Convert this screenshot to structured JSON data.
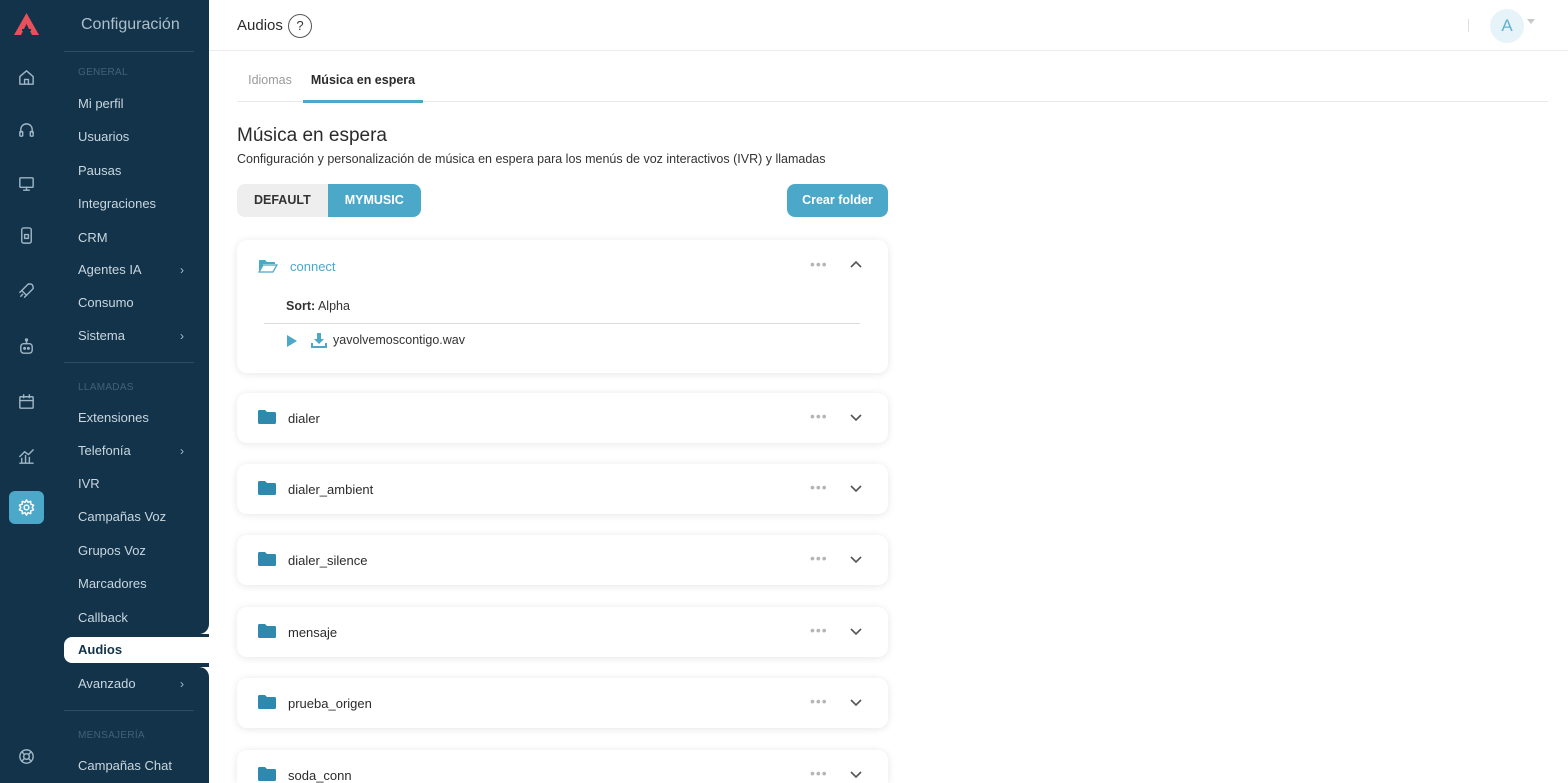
{
  "menu": {
    "title": "Configuración",
    "sections": {
      "general": "GENERAL",
      "llamadas": "LLAMADAS",
      "mensajeria": "MENSAJERÍA"
    },
    "general_items": [
      "Mi perfil",
      "Usuarios",
      "Pausas",
      "Integraciones",
      "CRM",
      "Agentes IA",
      "Consumo",
      "Sistema"
    ],
    "llamadas_items": [
      "Extensiones",
      "Telefonía",
      "IVR",
      "Campañas Voz",
      "Grupos Voz",
      "Marcadores",
      "Callback",
      "Audios",
      "Avanzado"
    ],
    "mensajeria_items": [
      "Campañas Chat"
    ],
    "active_item": "Audios",
    "chevron": "›"
  },
  "header": {
    "title": "Audios",
    "help": "?",
    "avatar_initial": "A"
  },
  "tabs": [
    "Idiomas",
    "Música en espera"
  ],
  "active_tab": "Música en espera",
  "content": {
    "heading": "Música en espera",
    "description": "Configuración y personalización de música en espera para los menús de voz interactivos (IVR) y llamadas",
    "segment": [
      "DEFAULT",
      "MYMUSIC"
    ],
    "selected_segment": "MYMUSIC",
    "create_button": "Crear folder"
  },
  "folders": [
    {
      "name": "connect",
      "expanded": true,
      "sort_label": "Sort:",
      "sort_value": "Alpha",
      "files": [
        "yavolvemoscontigo.wav"
      ]
    },
    {
      "name": "dialer",
      "expanded": false
    },
    {
      "name": "dialer_ambient",
      "expanded": false
    },
    {
      "name": "dialer_silence",
      "expanded": false
    },
    {
      "name": "mensaje",
      "expanded": false
    },
    {
      "name": "prueba_origen",
      "expanded": false
    },
    {
      "name": "soda_conn",
      "expanded": false
    }
  ],
  "more_glyph": "•••",
  "colors": {
    "sidebar": "#12334a",
    "accent": "#4ba8c9",
    "logo": "#e8505b"
  },
  "rail_icons": [
    "home-icon",
    "headset-icon",
    "monitor-icon",
    "phone-lock-icon",
    "rocket-icon",
    "robot-icon",
    "calendar-icon",
    "chart-icon",
    "settings-icon",
    "support-icon"
  ]
}
